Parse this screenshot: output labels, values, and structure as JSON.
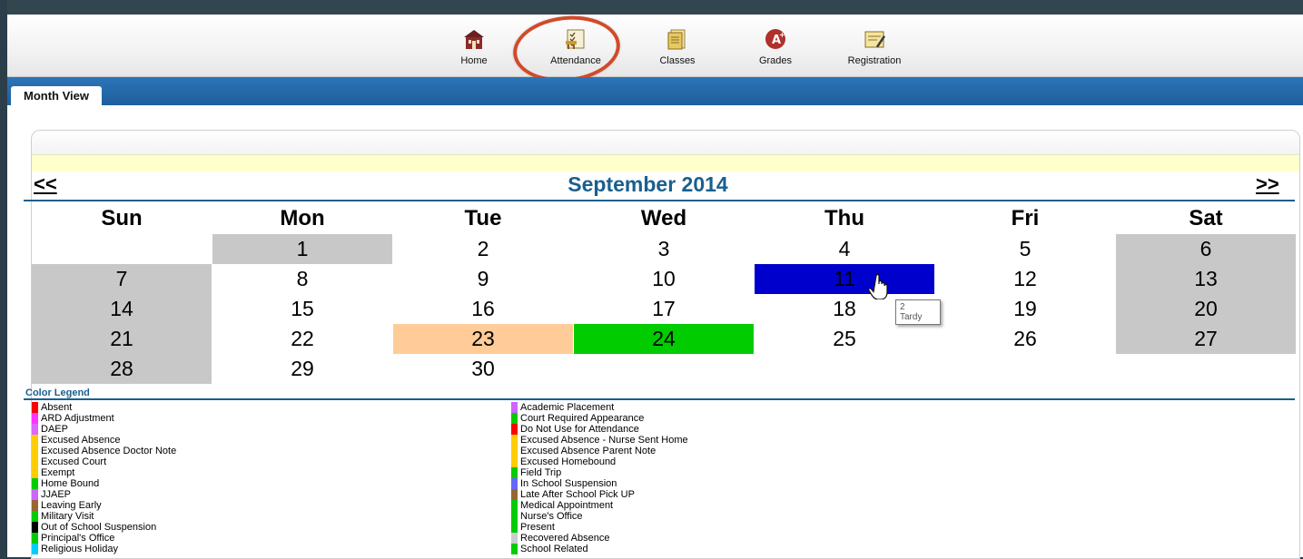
{
  "nav": {
    "items": [
      {
        "label": "Home",
        "icon": "schoolhouse-icon"
      },
      {
        "label": "Attendance",
        "icon": "desk-checklist-icon"
      },
      {
        "label": "Classes",
        "icon": "books-icon"
      },
      {
        "label": "Grades",
        "icon": "a-plus-icon"
      },
      {
        "label": "Registration",
        "icon": "clipboard-pencil-icon"
      }
    ],
    "highlight_color": "#d24a2a"
  },
  "tabs": [
    "Month View"
  ],
  "calendar": {
    "month_label": "September 2014",
    "prev_label": "<<",
    "next_label": ">>",
    "weekdays": [
      "Sun",
      "Mon",
      "Tue",
      "Wed",
      "Thu",
      "Fri",
      "Sat"
    ],
    "weeks": [
      [
        "",
        "1",
        "2",
        "3",
        "4",
        "5",
        "6"
      ],
      [
        "7",
        "8",
        "9",
        "10",
        "11",
        "12",
        "13"
      ],
      [
        "14",
        "15",
        "16",
        "17",
        "18",
        "19",
        "20"
      ],
      [
        "21",
        "22",
        "23",
        "24",
        "25",
        "26",
        "27"
      ],
      [
        "28",
        "29",
        "30",
        "",
        "",
        "",
        ""
      ]
    ],
    "shaded_days": [
      "1",
      "6",
      "7",
      "13",
      "14",
      "20",
      "21",
      "27",
      "28"
    ],
    "shade_color": "#c8c8c8",
    "status_days": [
      {
        "day": "11",
        "color": "#0000cc"
      },
      {
        "day": "23",
        "color": "#ffcc99"
      },
      {
        "day": "24",
        "color": "#00cc00"
      }
    ],
    "tooltip": {
      "line1": "2",
      "line2": "Tardy"
    }
  },
  "legend": {
    "title": "Color Legend",
    "left": [
      {
        "label": "Absent",
        "color": "#ff0000"
      },
      {
        "label": "ARD Adjustment",
        "color": "#ff33ff"
      },
      {
        "label": "DAEP",
        "color": "#dd66ff"
      },
      {
        "label": "Excused Absence",
        "color": "#ffcc00"
      },
      {
        "label": "Excused Absence Doctor Note",
        "color": "#ffcc00"
      },
      {
        "label": "Excused Court",
        "color": "#ffcc00"
      },
      {
        "label": "Exempt",
        "color": "#ffcc00"
      },
      {
        "label": "Home Bound",
        "color": "#00cc00"
      },
      {
        "label": "JJAEP",
        "color": "#cc66ff"
      },
      {
        "label": "Leaving Early",
        "color": "#996633"
      },
      {
        "label": "Military Visit",
        "color": "#00cc00"
      },
      {
        "label": "Out of School Suspension",
        "color": "#000000"
      },
      {
        "label": "Principal's Office",
        "color": "#00cc00"
      },
      {
        "label": "Religious Holiday",
        "color": "#00ccff"
      }
    ],
    "right": [
      {
        "label": "Academic Placement",
        "color": "#cc66ff"
      },
      {
        "label": "Court Required Appearance",
        "color": "#00cc00"
      },
      {
        "label": "Do Not Use for Attendance",
        "color": "#ff0000"
      },
      {
        "label": "Excused Absence - Nurse Sent Home",
        "color": "#ffcc00"
      },
      {
        "label": "Excused Absence Parent Note",
        "color": "#ffcc00"
      },
      {
        "label": "Excused Homebound",
        "color": "#ffcc00"
      },
      {
        "label": "Field Trip",
        "color": "#00cc00"
      },
      {
        "label": "In School Suspension",
        "color": "#6666ff"
      },
      {
        "label": "Late After School Pick UP",
        "color": "#996633"
      },
      {
        "label": "Medical Appointment",
        "color": "#00cc00"
      },
      {
        "label": "Nurse's Office",
        "color": "#00cc00"
      },
      {
        "label": "Present",
        "color": "#00cc00"
      },
      {
        "label": "Recovered Absence",
        "color": "#cccccc"
      },
      {
        "label": "School Related",
        "color": "#00cc00"
      }
    ]
  }
}
